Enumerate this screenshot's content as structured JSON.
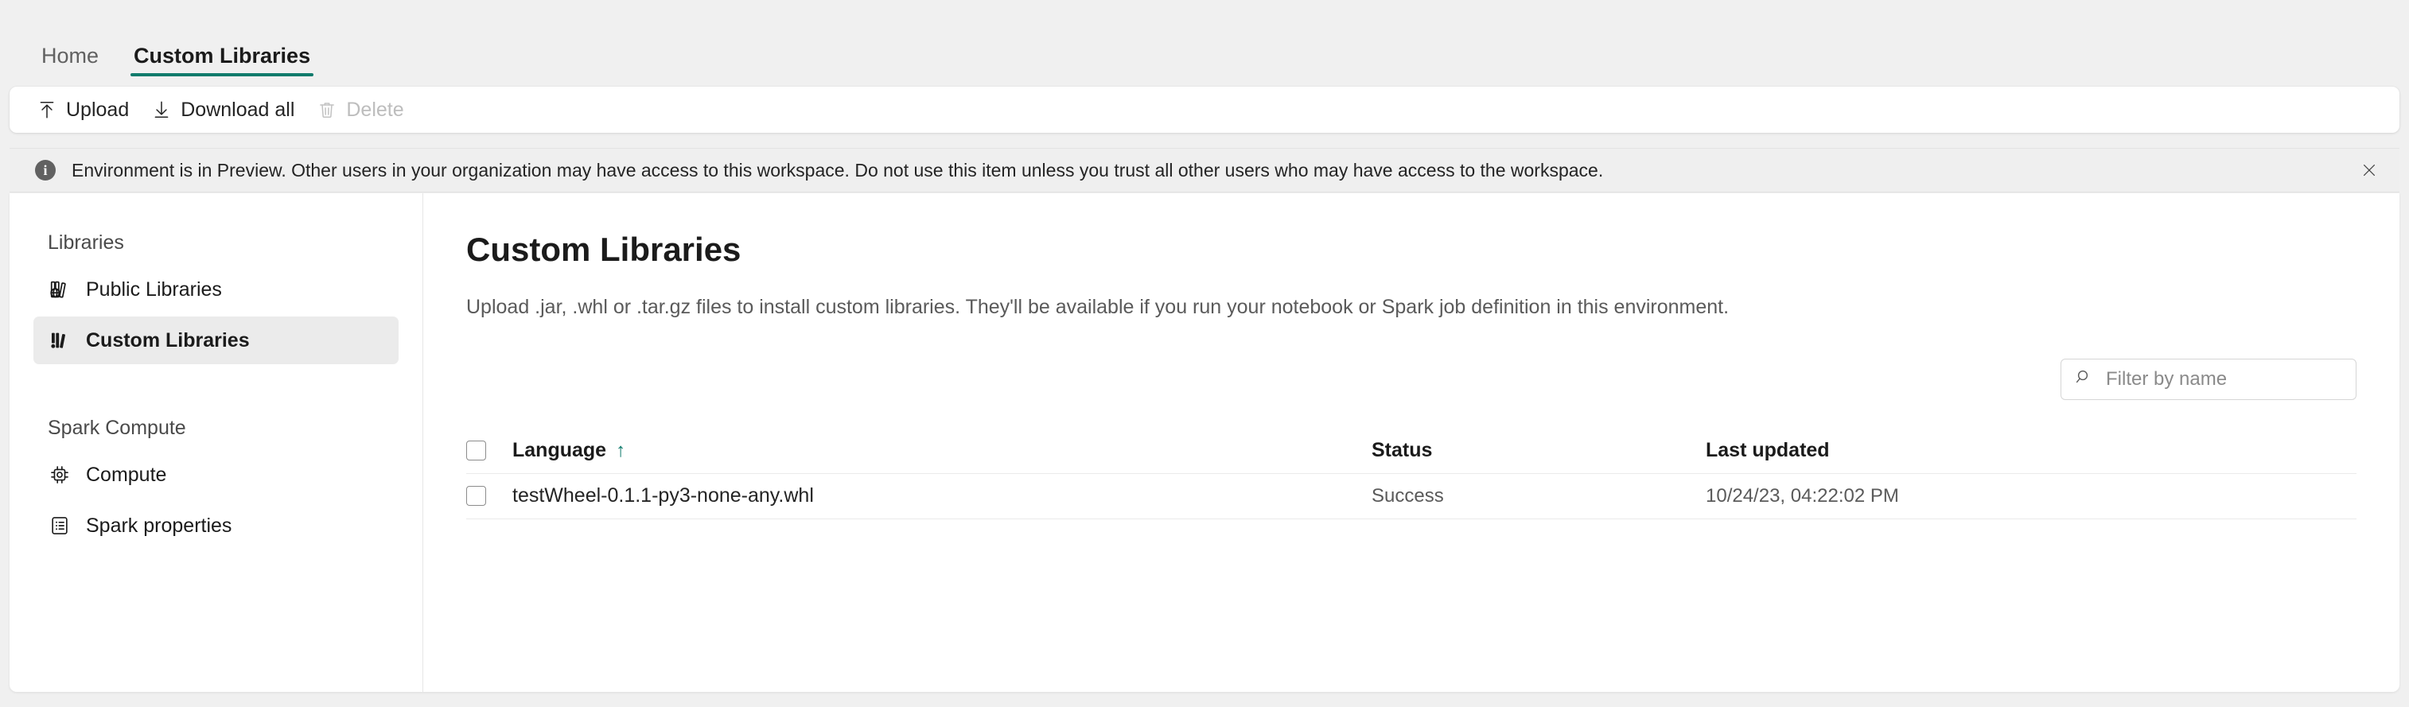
{
  "theme": {
    "accent": "#0f7b6c",
    "selected_bg": "#ebebeb",
    "page_bg": "#f0f0f0"
  },
  "tabs": [
    {
      "label": "Home",
      "active": false
    },
    {
      "label": "Custom Libraries",
      "active": true
    }
  ],
  "toolbar": {
    "upload_label": "Upload",
    "download_all_label": "Download all",
    "delete_label": "Delete"
  },
  "banner": {
    "text": "Environment is in Preview. Other users in your organization may have access to this workspace. Do not use this item unless you trust all other users who may have access to the workspace.",
    "icon": "info-icon",
    "close_icon": "close-icon"
  },
  "sidebar": {
    "groups": [
      {
        "title": "Libraries",
        "items": [
          {
            "label": "Public Libraries",
            "icon": "public-libraries-icon",
            "selected": false
          },
          {
            "label": "Custom Libraries",
            "icon": "custom-libraries-icon",
            "selected": true
          }
        ]
      },
      {
        "title": "Spark Compute",
        "items": [
          {
            "label": "Compute",
            "icon": "chip-icon",
            "selected": false
          },
          {
            "label": "Spark properties",
            "icon": "list-icon",
            "selected": false
          }
        ]
      }
    ]
  },
  "main": {
    "title": "Custom Libraries",
    "description": "Upload .jar, .whl or .tar.gz files to install custom libraries. They'll be available if you run your notebook or Spark job definition in this environment.",
    "search": {
      "placeholder": "Filter by name",
      "value": "",
      "icon": "search-icon"
    },
    "table": {
      "columns": {
        "language": "Language",
        "status": "Status",
        "last_updated": "Last updated"
      },
      "sort": {
        "column": "Language",
        "direction": "ascending",
        "glyph": "↑"
      },
      "rows": [
        {
          "language": "testWheel-0.1.1-py3-none-any.whl",
          "status": "Success",
          "last_updated": "10/24/23, 04:22:02 PM",
          "checked": false
        }
      ]
    }
  }
}
